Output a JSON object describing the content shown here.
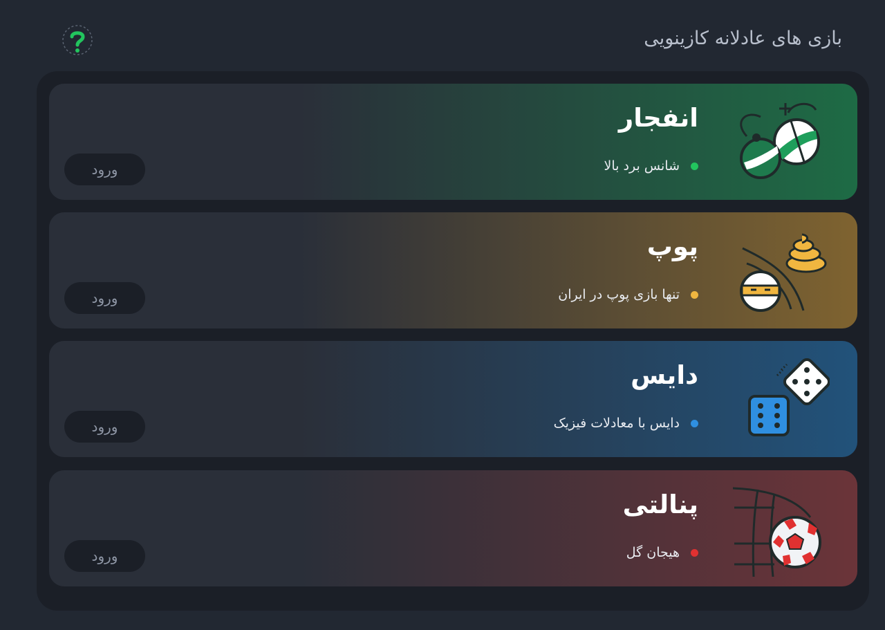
{
  "header": {
    "title": "بازی های عادلانه کازینویی",
    "help_icon": "question-mark-icon"
  },
  "games": [
    {
      "name": "انفجار",
      "subtitle": "شانس برد بالا",
      "enter_label": "ورود",
      "icon": "bomb-icon",
      "accent": "#1e6b45",
      "dot_color": "#22c55e"
    },
    {
      "name": "پوپ",
      "subtitle": "تنها بازی پوپ در ایران",
      "enter_label": "ورود",
      "icon": "poop-ninja-icon",
      "accent": "#7f6330",
      "dot_color": "#f0b640"
    },
    {
      "name": "دایس",
      "subtitle": "دایس با معادلات فیزیک",
      "enter_label": "ورود",
      "icon": "dice-icon",
      "accent": "#22527a",
      "dot_color": "#2f8fe0"
    },
    {
      "name": "پنالتی",
      "subtitle": "هیجان گل",
      "enter_label": "ورود",
      "icon": "soccer-ball-goal-icon",
      "accent": "#6b3439",
      "dot_color": "#e03131"
    }
  ]
}
